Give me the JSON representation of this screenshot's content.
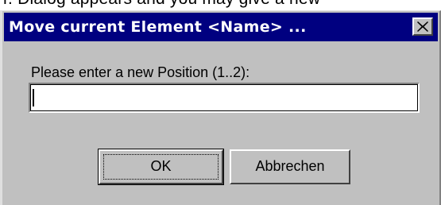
{
  "background_text": "r. Dialog appears and you may give a new",
  "dialog": {
    "title": "Move current Element <Name> ...",
    "prompt": "Please enter a new Position (1..2):",
    "position_value": "",
    "ok_label": "OK",
    "cancel_label": "Abbrechen"
  },
  "icons": {
    "close": "close-icon"
  },
  "colors": {
    "titlebar": "#000080",
    "face": "#c0c0c0",
    "title_text": "#ffffff"
  }
}
